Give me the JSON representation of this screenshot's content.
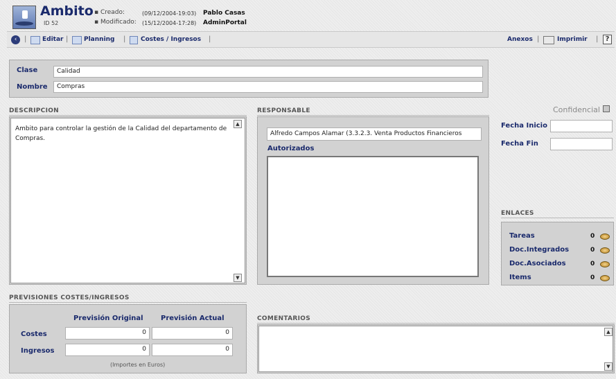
{
  "header": {
    "title": "Ambito",
    "id_text": "ID 52",
    "created_label": "▪ Creado:",
    "created_date": "(09/12/2004-19:03)",
    "created_user": "Pablo Casas",
    "modified_label": "▪ Modificado:",
    "modified_date": "(15/12/2004-17:28)",
    "modified_user": "AdminPortal"
  },
  "toolbar": {
    "editar": "Editar",
    "planning": "Planning",
    "costes_ingresos": "Costes / Ingresos",
    "anexos": "Anexos",
    "imprimir": "Imprimir",
    "sep": "|"
  },
  "fields": {
    "clase_label": "Clase",
    "clase_value": "Calidad",
    "nombre_label": "Nombre",
    "nombre_value": "Compras"
  },
  "descripcion": {
    "title": "DESCRIPCION",
    "text": "Ambito para controlar la gestión de la Calidad del departamento de Compras."
  },
  "responsable": {
    "title": "RESPONSABLE",
    "value": "Alfredo Campos  Alamar (3.3.2.3. Venta Productos Financieros",
    "autorizados_label": "Autorizados"
  },
  "right": {
    "confidencial_label": "Confidencial",
    "fecha_inicio_label": "Fecha Inicio",
    "fecha_inicio_value": "",
    "fecha_fin_label": "Fecha Fin",
    "fecha_fin_value": ""
  },
  "enlaces": {
    "title": "ENLACES",
    "items": [
      {
        "label": "Tareas",
        "count": "0"
      },
      {
        "label": "Doc.Integrados",
        "count": "0"
      },
      {
        "label": "Doc.Asociados",
        "count": "0"
      },
      {
        "label": "Items",
        "count": "0"
      }
    ]
  },
  "previsiones": {
    "title": "PREVISIONES COSTES/INGRESOS",
    "col_original": "Previsión Original",
    "col_actual": "Previsión Actual",
    "rows": [
      {
        "label": "Costes",
        "original": "0",
        "actual": "0"
      },
      {
        "label": "Ingresos",
        "original": "0",
        "actual": "0"
      }
    ],
    "note": "(Importes en Euros)"
  },
  "comentarios": {
    "title": "COMENTARIOS",
    "text": ""
  },
  "icons": {
    "back": "back-circle-icon",
    "edit": "edit-icon",
    "planning": "calendar-grid-icon",
    "costes": "document-icon",
    "print": "printer-icon",
    "help": "help-icon",
    "link": "disc-icon"
  }
}
